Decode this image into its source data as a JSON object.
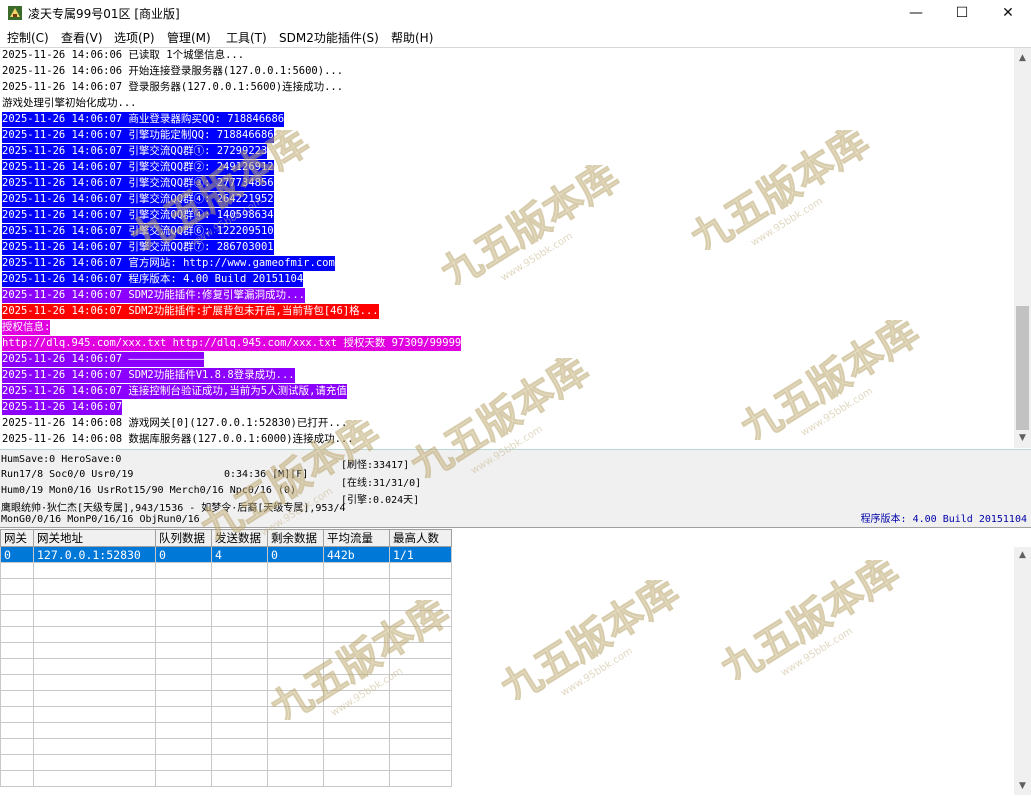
{
  "window": {
    "title": "凌天专属99号01区 [商业版]",
    "controls": {
      "minimize": "—",
      "maximize": "☐",
      "close": "✕"
    }
  },
  "menu": [
    "控制(C)",
    "查看(V)",
    "选项(P)",
    "管理(M)",
    "工具(T)",
    "SDM2功能插件(S)",
    "帮助(H)"
  ],
  "log_lines": [
    {
      "text": "2025-11-26 14:06:06 已读取 1个城堡信息...",
      "fg": "#000000",
      "bg": ""
    },
    {
      "text": "2025-11-26 14:06:06 开始连接登录服务器(127.0.0.1:5600)...",
      "fg": "#000000",
      "bg": ""
    },
    {
      "text": "2025-11-26 14:06:07 登录服务器(127.0.0.1:5600)连接成功...",
      "fg": "#000000",
      "bg": ""
    },
    {
      "text": "游戏处理引擎初始化成功...",
      "fg": "#000000",
      "bg": ""
    },
    {
      "text": "2025-11-26 14:06:07 商业登录器购买QQ: 718846686",
      "fg": "#ffffff",
      "bg": "#0000ff"
    },
    {
      "text": "2025-11-26 14:06:07 引擎功能定制QQ: 718846686",
      "fg": "#ffffff",
      "bg": "#0000ff"
    },
    {
      "text": "2025-11-26 14:06:07 引擎交流QQ群①: 27299223",
      "fg": "#ffffff",
      "bg": "#0000ff"
    },
    {
      "text": "2025-11-26 14:06:07 引擎交流QQ群②: 249126912",
      "fg": "#ffffff",
      "bg": "#0000ff"
    },
    {
      "text": "2025-11-26 14:06:07 引擎交流QQ群③: 277734856",
      "fg": "#ffffff",
      "bg": "#0000ff"
    },
    {
      "text": "2025-11-26 14:06:07 引擎交流QQ群④: 264221952",
      "fg": "#ffffff",
      "bg": "#0000ff"
    },
    {
      "text": "2025-11-26 14:06:07 引擎交流QQ群④: 140598634",
      "fg": "#ffffff",
      "bg": "#0000ff"
    },
    {
      "text": "2025-11-26 14:06:07 引擎交流QQ群⑥: 122209510",
      "fg": "#ffffff",
      "bg": "#0000ff"
    },
    {
      "text": "2025-11-26 14:06:07 引擎交流QQ群⑦: 286703001",
      "fg": "#ffffff",
      "bg": "#0000ff"
    },
    {
      "text": "2025-11-26 14:06:07 官方网站: http://www.gameofmir.com",
      "fg": "#ffffff",
      "bg": "#0000ff"
    },
    {
      "text": "2025-11-26 14:06:07 程序版本: 4.00 Build 20151104",
      "fg": "#ffffff",
      "bg": "#0000ff"
    },
    {
      "text": "2025-11-26 14:06:07 SDM2功能插件:修复引擎漏洞成功...",
      "fg": "#ffffff",
      "bg": "#8b00ff"
    },
    {
      "text": "2025-11-26 14:06:07 SDM2功能插件:扩展背包未开启,当前背包[46]格...",
      "fg": "#ffffff",
      "bg": "#ff0000"
    },
    {
      "text": "授权信息:",
      "fg": "#ffffff",
      "bg": "#e000e0"
    },
    {
      "text": "http://dlq.945.com/xxx.txt http://dlq.945.com/xxx.txt 授权天数 97309/99999",
      "fg": "#ffffff",
      "bg": "#e000e0"
    },
    {
      "text": "2025-11-26 14:06:07 ————————————",
      "fg": "#ffffff",
      "bg": "#8b00ff"
    },
    {
      "text": "2025-11-26 14:06:07 SDM2功能插件V1.8.8登录成功...",
      "fg": "#ffffff",
      "bg": "#8b00ff"
    },
    {
      "text": "2025-11-26 14:06:07 连接控制台验证成功,当前为5人测试版,请充值",
      "fg": "#ffffff",
      "bg": "#8b00ff"
    },
    {
      "text": "2025-11-26 14:06:07 ",
      "fg": "#ffffff",
      "bg": "#8b00ff"
    },
    {
      "text": "2025-11-26 14:06:08 游戏网关[0](127.0.0.1:52830)已打开...",
      "fg": "#000000",
      "bg": ""
    },
    {
      "text": "2025-11-26 14:06:08 数据库服务器(127.0.0.1:6000)连接成功...",
      "fg": "#000000",
      "bg": ""
    }
  ],
  "status": {
    "line1": "HumSave:0 HeroSave:0",
    "line2_left": "Run17/8 Soc0/0 Usr0/19",
    "line2_time": "0:34:36 [M][F]",
    "line3": "Hum0/19 Mon0/16 UsrRot15/90 Merch0/16 Npc0/16 (0)",
    "line4": "鹰眼统帅·狄仁杰[天级专属],943/1536 - 如梦令·后裔[天级专属],953/4",
    "line5": "MonG0/0/16 MonP0/16/16 ObjRun0/16",
    "refresh": "[刷怪:33417]",
    "online": "[在线:31/31/0]",
    "engine": "[引擎:0.024天]",
    "version": "程序版本: 4.00 Build 20151104"
  },
  "gateway_table": {
    "columns": [
      "网关",
      "网关地址",
      "队列数据",
      "发送数据",
      "剩余数据",
      "平均流量",
      "最高人数"
    ],
    "rows": [
      [
        "0",
        "127.0.0.1:52830",
        "0",
        "4",
        "0",
        "442b",
        "1/1"
      ]
    ],
    "empty_rows": 14
  },
  "watermark": {
    "text": "九五版本库",
    "url": "www.95bbk.com"
  },
  "colors": {
    "selection": "#0078d7",
    "log_blue": "#0000ff",
    "log_purple": "#8b00ff",
    "log_red": "#ff0000",
    "log_magenta": "#e000e0",
    "version_blue": "#0000aa"
  }
}
